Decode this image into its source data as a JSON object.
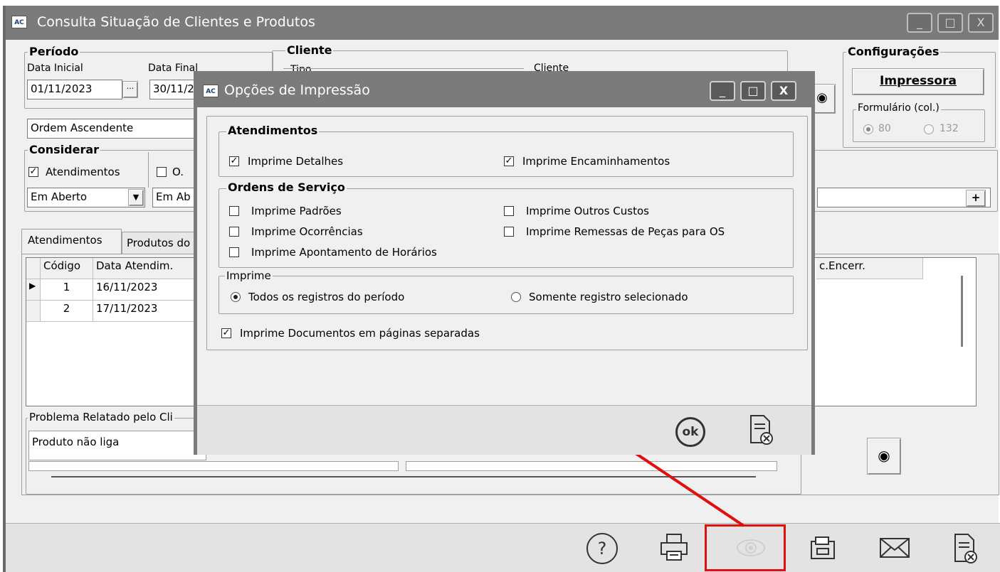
{
  "main_window": {
    "title": "Consulta Situação de Clientes e Produtos",
    "app_icon": "AC",
    "controls": [
      "_",
      "□",
      "X"
    ]
  },
  "periodo": {
    "legend": "Período",
    "data_inicial_label": "Data Inicial",
    "data_inicial_value": "01/11/2023",
    "data_final_label": "Data Final",
    "data_final_value": "30/11/2",
    "browse_label": "···"
  },
  "cliente": {
    "legend": "Cliente",
    "tipo_label": "Tipo",
    "cliente_label": "Cliente"
  },
  "configuracoes": {
    "legend": "Configurações",
    "impressora_button": "Impressora",
    "formulario_legend": "Formulário (col.)",
    "option_80": "80",
    "option_132": "132"
  },
  "ordem": {
    "value": "Ordem Ascendente"
  },
  "considerar": {
    "legend": "Considerar",
    "atendimentos_label": "Atendimentos",
    "atendimentos_checked": true,
    "os_label": "O.",
    "atendimentos_status": "Em Aberto",
    "os_status": "Em Ab"
  },
  "plus_button": "+",
  "tabs": [
    {
      "label": "Atendimentos"
    },
    {
      "label": "Produtos do"
    }
  ],
  "grid": {
    "columns": [
      "Código",
      "Data Atendim."
    ],
    "right_column": "c.Encerr.",
    "rows": [
      {
        "codigo": "1",
        "data": "16/11/2023"
      },
      {
        "codigo": "2",
        "data": "17/11/2023"
      }
    ]
  },
  "problema": {
    "legend": "Problema Relatado pelo Cli",
    "value": "Produto não liga"
  },
  "dialog": {
    "title": "Opções de Impressão",
    "app_icon": "AC",
    "atendimentos": {
      "legend": "Atendimentos",
      "imprime_detalhes": "Imprime Detalhes",
      "imprime_encaminhamentos": "Imprime Encaminhamentos"
    },
    "ordens_servico": {
      "legend": "Ordens de Serviço",
      "imprime_padroes": "Imprime Padrões",
      "imprime_outros_custos": "Imprime Outros Custos",
      "imprime_ocorrencias": "Imprime Ocorrências",
      "imprime_remessas": "Imprime Remessas de Peças para OS",
      "imprime_apontamento": "Imprime Apontamento de Horários"
    },
    "imprime": {
      "legend": "Imprime",
      "todos": "Todos os registros do período",
      "somente": "Somente registro selecionado"
    },
    "documentos_separados": "Imprime Documentos em páginas separadas",
    "ok_label": "ok"
  },
  "toolbar": {
    "help_icon": "?"
  },
  "colors": {
    "titlebar": "#7b7b7b",
    "window_bg": "#f0f0f0",
    "highlight": "#e01010"
  }
}
